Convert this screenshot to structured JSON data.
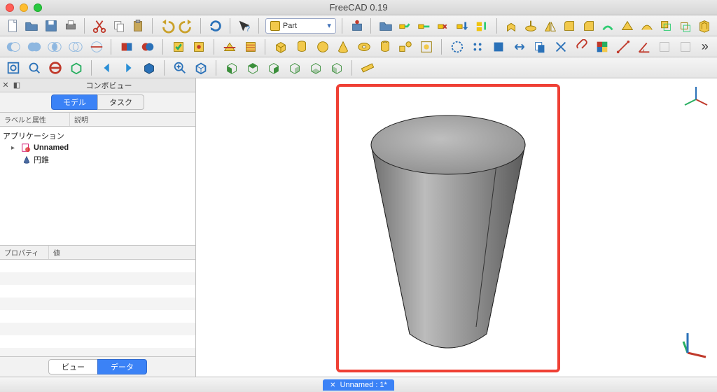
{
  "app": {
    "title": "FreeCAD 0.19"
  },
  "workbench": {
    "selected": "Part"
  },
  "combo": {
    "title": "コンボビュー",
    "tabs": {
      "model": "モデル",
      "task": "タスク"
    },
    "tree_headers": {
      "col1": "ラベルと属性",
      "col2": "説明"
    },
    "tree": {
      "root": "アプリケーション",
      "doc": "Unnamed",
      "item": "円錐"
    },
    "prop_headers": {
      "col1": "プロパティ",
      "col2": "値"
    },
    "bottom_tabs": {
      "view": "ビュー",
      "data": "データ"
    }
  },
  "status": {
    "doc_tab": "Unnamed : 1*"
  }
}
